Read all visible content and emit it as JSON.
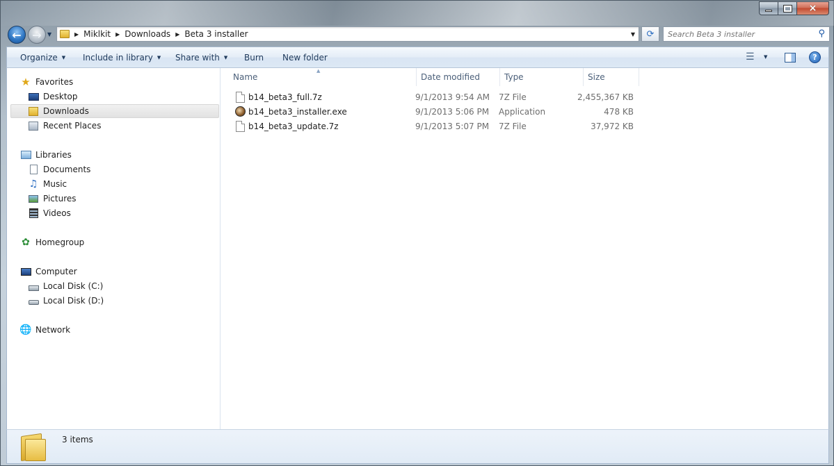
{
  "window": {
    "caption_buttons": {
      "minimize": "minimize",
      "maximize": "maximize",
      "close": "×"
    }
  },
  "nav": {
    "breadcrumbs": [
      "Miklkit",
      "Downloads",
      "Beta 3 installer"
    ],
    "search_placeholder": "Search Beta 3 installer"
  },
  "toolbar": {
    "organize": "Organize",
    "include_in_library": "Include in library",
    "share_with": "Share with",
    "burn": "Burn",
    "new_folder": "New folder"
  },
  "sidebar": {
    "favorites": "Favorites",
    "desktop": "Desktop",
    "downloads": "Downloads",
    "recent_places": "Recent Places",
    "libraries": "Libraries",
    "documents": "Documents",
    "music": "Music",
    "pictures": "Pictures",
    "videos": "Videos",
    "homegroup": "Homegroup",
    "computer": "Computer",
    "local_disk_c": "Local Disk (C:)",
    "local_disk_d": "Local Disk (D:)",
    "network": "Network"
  },
  "columns": {
    "name": "Name",
    "date": "Date modified",
    "type": "Type",
    "size": "Size"
  },
  "files": [
    {
      "name": "b14_beta3_full.7z",
      "date": "9/1/2013 9:54 AM",
      "type": "7Z File",
      "size": "2,455,367 KB",
      "icon": "7z-file-icon"
    },
    {
      "name": "b14_beta3_installer.exe",
      "date": "9/1/2013 5:06 PM",
      "type": "Application",
      "size": "478 KB",
      "icon": "application-icon"
    },
    {
      "name": "b14_beta3_update.7z",
      "date": "9/1/2013 5:07 PM",
      "type": "7Z File",
      "size": "37,972 KB",
      "icon": "7z-file-icon"
    }
  ],
  "status": {
    "items_count": "3 items"
  },
  "colors": {
    "accent": "#1e395b",
    "selection": "#e5e5e5",
    "folder": "#e7bd43"
  }
}
